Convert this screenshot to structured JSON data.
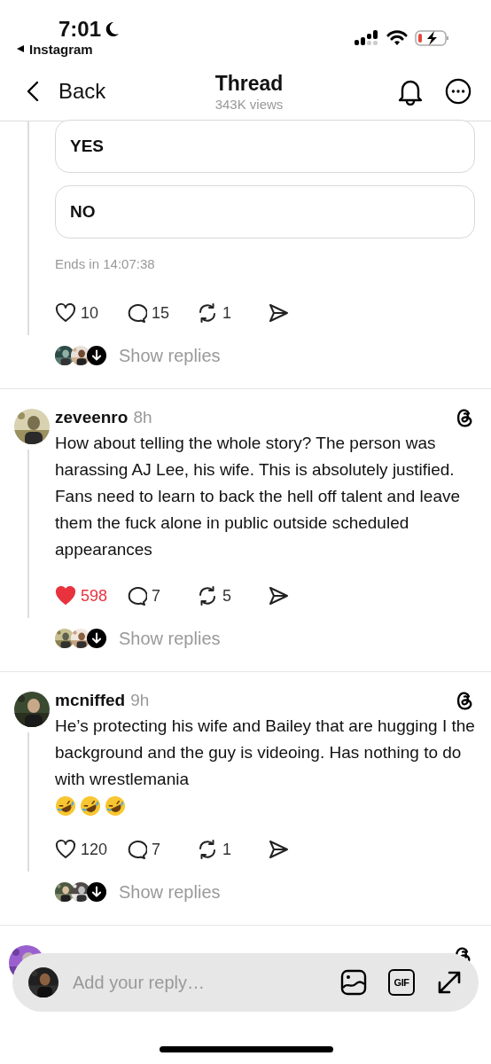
{
  "status_bar": {
    "time": "7:01",
    "back_app": "Instagram"
  },
  "header": {
    "back": "Back",
    "title": "Thread",
    "views": "343K views"
  },
  "poll": {
    "options": [
      {
        "label": "YES"
      },
      {
        "label": "NO"
      }
    ],
    "ends": "Ends in 14:07:38",
    "liked": false,
    "likes": "10",
    "replies": "15",
    "reposts": "1",
    "show_replies": "Show replies"
  },
  "posts": [
    {
      "username": "zeveenro",
      "time": "8h",
      "text": "How about telling the whole story? The person was harassing AJ Lee, his wife. This is absolutely justified. Fans need to learn to back the hell off talent and leave them the fuck alone in public outside scheduled appearances",
      "liked": true,
      "likes": "598",
      "replies": "7",
      "reposts": "5",
      "show_replies": "Show replies"
    },
    {
      "username": "mcniffed",
      "time": "9h",
      "text": "He’s protecting his wife and Bailey that are hugging I the background and the guy is videoing. Has nothing to do with wrestlemania",
      "emojis": [
        {
          "kind": "rolling-laughing"
        },
        {
          "kind": "rolling-laughing"
        },
        {
          "kind": "rolling-laughing"
        }
      ],
      "liked": false,
      "likes": "120",
      "replies": "7",
      "reposts": "1",
      "show_replies": "Show replies"
    }
  ],
  "reply_bar": {
    "placeholder": "Add your reply…",
    "gif_label": "GIF"
  }
}
